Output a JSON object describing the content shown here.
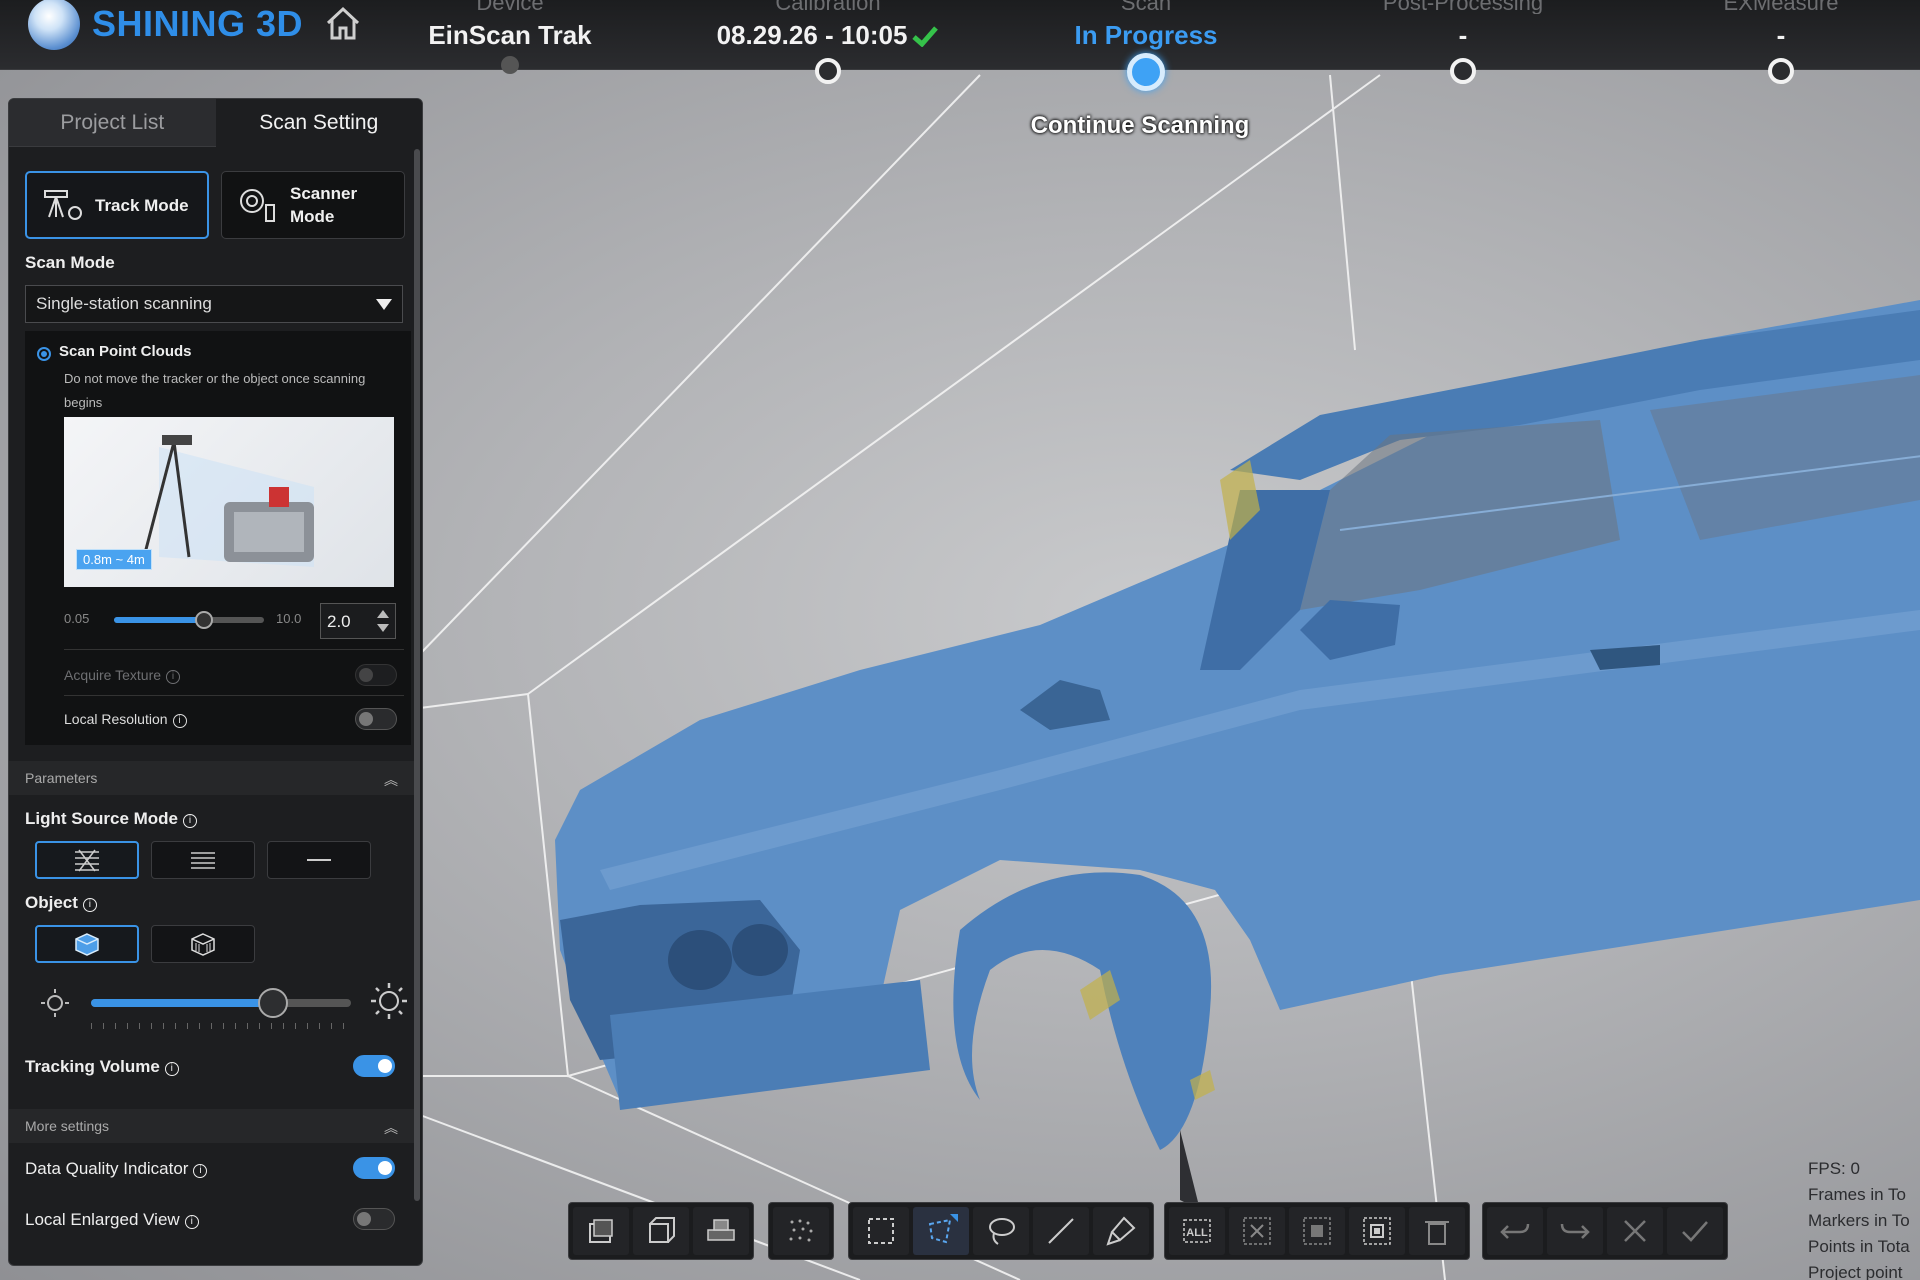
{
  "header": {
    "brand": "SHINING 3D",
    "steps": [
      {
        "ghost": "Device",
        "value": "EinScan Trak",
        "active": false
      },
      {
        "ghost": "Calibration",
        "value": "08.29.26 - 10:05",
        "active": false
      },
      {
        "ghost": "Scan",
        "value": "In Progress",
        "active": true
      },
      {
        "ghost": "Post-Processing",
        "value": "-",
        "active": false
      },
      {
        "ghost": "EXMeasure",
        "value": "-",
        "active": false
      }
    ],
    "continue_label": "Continue Scanning"
  },
  "panel": {
    "tabs": [
      {
        "label": "Project List"
      },
      {
        "label": "Scan Setting"
      }
    ],
    "modes": [
      {
        "label": "Track Mode",
        "selected": true
      },
      {
        "label": "Scanner\nMode",
        "selected": false
      }
    ],
    "scan_mode_label": "Scan Mode",
    "scan_mode_value": "Single-station scanning",
    "scan_point_clouds": {
      "title": "Scan Point Clouds",
      "hint": "Do not move the tracker or the object once scanning begins",
      "range_tag": "0.8m ~ 4m",
      "slider_min": "0.05",
      "slider_max": "10.0",
      "value": "2.0",
      "level": 0.6
    },
    "acquire_texture": {
      "label": "Acquire Texture",
      "on": false,
      "disabled": true
    },
    "local_resolution": {
      "label": "Local Resolution",
      "on": false
    },
    "parameters_section": "Parameters",
    "light_source_mode": {
      "label": "Light Source Mode",
      "selected_index": 0
    },
    "object": {
      "label": "Object",
      "selected_index": 0
    },
    "brightness_level": 0.7,
    "tracking_volume": {
      "label": "Tracking Volume",
      "on": true
    },
    "more_settings_section": "More settings",
    "data_quality_indicator": {
      "label": "Data Quality Indicator",
      "on": true
    },
    "local_enlarged_view": {
      "label": "Local Enlarged View",
      "on": false
    }
  },
  "stats": [
    "FPS: 0",
    "Frames in To",
    "Markers in To",
    "Points in Tota",
    "Project point"
  ],
  "colors": {
    "accent": "#3a93e6",
    "scan_blue": "#5b8ec4",
    "brand": "#2f8ee8"
  }
}
